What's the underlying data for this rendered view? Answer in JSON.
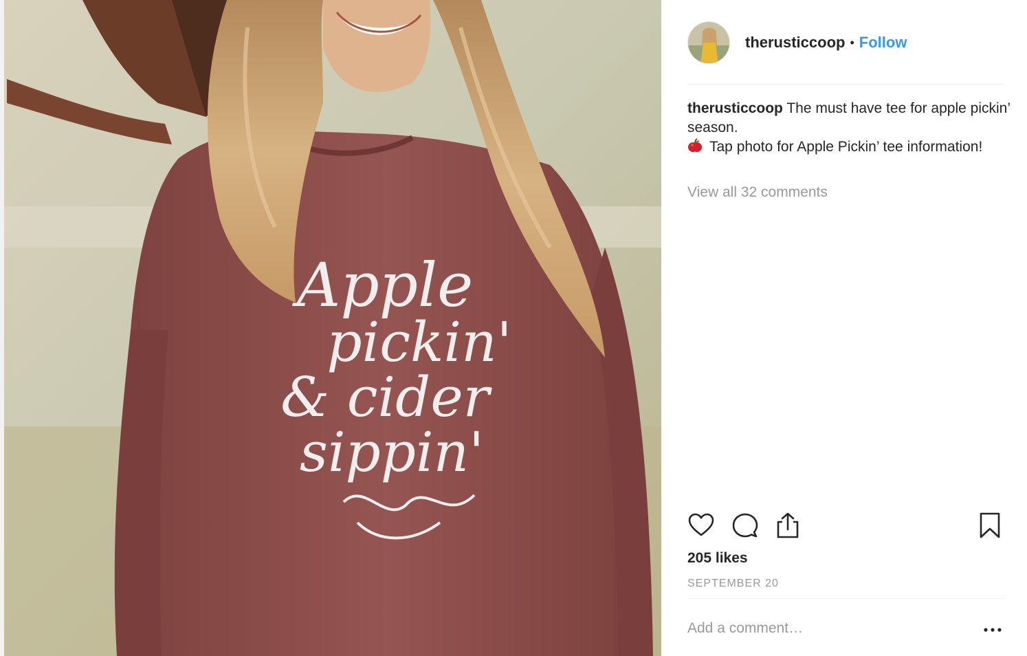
{
  "post": {
    "username": "therusticcoop",
    "separator": "•",
    "follow_label": "Follow",
    "caption_username": "therusticcoop",
    "caption_line1": "The must have tee for apple pickin’ season.",
    "caption_line2": "Tap photo for Apple Pickin’ tee information!",
    "caption_emoji": "apple-emoji",
    "view_comments": "View all 32 comments",
    "likes": "205 likes",
    "date": "SEPTEMBER 20",
    "comment_placeholder": "Add a comment…"
  },
  "shirt_print": [
    "Apple",
    "pickin'",
    "& cider",
    "sippin'"
  ],
  "icons": [
    "heart-icon",
    "comment-icon",
    "share-icon",
    "bookmark-icon",
    "more-options-icon"
  ],
  "colors": {
    "follow_blue": "#3897f0",
    "text_dark": "#262626",
    "text_muted": "#999999",
    "shirt": "#8e4f4c"
  }
}
